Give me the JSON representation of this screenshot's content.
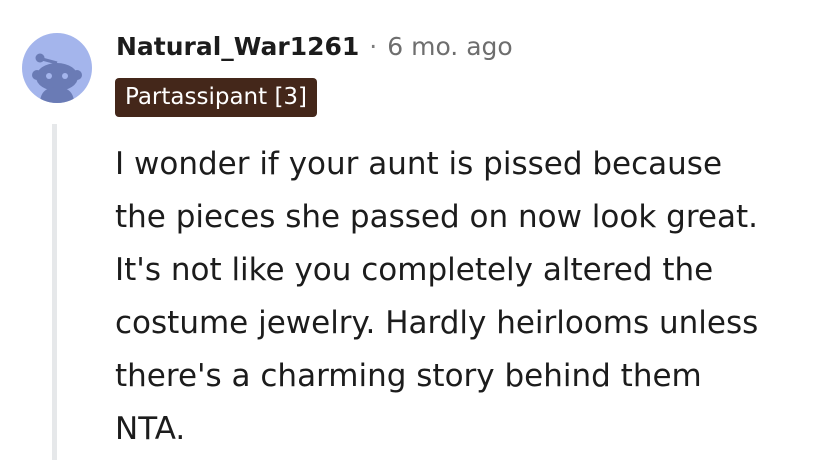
{
  "comment": {
    "author": "Natural_War1261",
    "separator": "·",
    "timestamp": "6 mo. ago",
    "flair": "Partassipant [3]",
    "body_lines": [
      "I wonder if your aunt is pissed because",
      "the pieces she passed on now look great.",
      "It's not like you completely altered the",
      "costume jewelry. Hardly heirlooms unless",
      "there's a charming story behind them",
      "NTA."
    ]
  },
  "colors": {
    "avatar_bg": "#a4b5ec",
    "flair_bg": "#44271a",
    "thread_line": "#e6e8ea"
  },
  "icons": {
    "avatar": "snoo-avatar-icon"
  }
}
